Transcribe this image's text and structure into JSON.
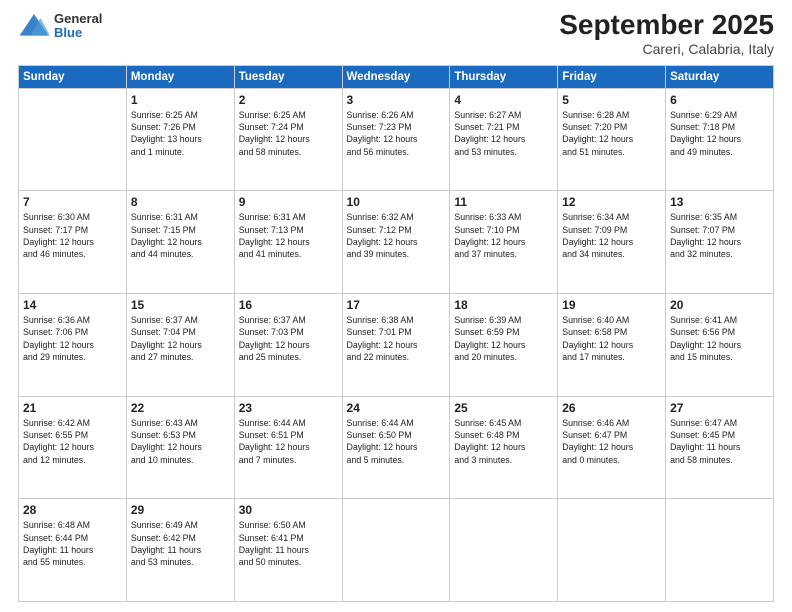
{
  "header": {
    "logo": {
      "general": "General",
      "blue": "Blue"
    },
    "title": "September 2025",
    "subtitle": "Careri, Calabria, Italy"
  },
  "weekdays": [
    "Sunday",
    "Monday",
    "Tuesday",
    "Wednesday",
    "Thursday",
    "Friday",
    "Saturday"
  ],
  "weeks": [
    [
      {
        "day": "",
        "info": ""
      },
      {
        "day": "1",
        "info": "Sunrise: 6:25 AM\nSunset: 7:26 PM\nDaylight: 13 hours\nand 1 minute."
      },
      {
        "day": "2",
        "info": "Sunrise: 6:25 AM\nSunset: 7:24 PM\nDaylight: 12 hours\nand 58 minutes."
      },
      {
        "day": "3",
        "info": "Sunrise: 6:26 AM\nSunset: 7:23 PM\nDaylight: 12 hours\nand 56 minutes."
      },
      {
        "day": "4",
        "info": "Sunrise: 6:27 AM\nSunset: 7:21 PM\nDaylight: 12 hours\nand 53 minutes."
      },
      {
        "day": "5",
        "info": "Sunrise: 6:28 AM\nSunset: 7:20 PM\nDaylight: 12 hours\nand 51 minutes."
      },
      {
        "day": "6",
        "info": "Sunrise: 6:29 AM\nSunset: 7:18 PM\nDaylight: 12 hours\nand 49 minutes."
      }
    ],
    [
      {
        "day": "7",
        "info": "Sunrise: 6:30 AM\nSunset: 7:17 PM\nDaylight: 12 hours\nand 46 minutes."
      },
      {
        "day": "8",
        "info": "Sunrise: 6:31 AM\nSunset: 7:15 PM\nDaylight: 12 hours\nand 44 minutes."
      },
      {
        "day": "9",
        "info": "Sunrise: 6:31 AM\nSunset: 7:13 PM\nDaylight: 12 hours\nand 41 minutes."
      },
      {
        "day": "10",
        "info": "Sunrise: 6:32 AM\nSunset: 7:12 PM\nDaylight: 12 hours\nand 39 minutes."
      },
      {
        "day": "11",
        "info": "Sunrise: 6:33 AM\nSunset: 7:10 PM\nDaylight: 12 hours\nand 37 minutes."
      },
      {
        "day": "12",
        "info": "Sunrise: 6:34 AM\nSunset: 7:09 PM\nDaylight: 12 hours\nand 34 minutes."
      },
      {
        "day": "13",
        "info": "Sunrise: 6:35 AM\nSunset: 7:07 PM\nDaylight: 12 hours\nand 32 minutes."
      }
    ],
    [
      {
        "day": "14",
        "info": "Sunrise: 6:36 AM\nSunset: 7:06 PM\nDaylight: 12 hours\nand 29 minutes."
      },
      {
        "day": "15",
        "info": "Sunrise: 6:37 AM\nSunset: 7:04 PM\nDaylight: 12 hours\nand 27 minutes."
      },
      {
        "day": "16",
        "info": "Sunrise: 6:37 AM\nSunset: 7:03 PM\nDaylight: 12 hours\nand 25 minutes."
      },
      {
        "day": "17",
        "info": "Sunrise: 6:38 AM\nSunset: 7:01 PM\nDaylight: 12 hours\nand 22 minutes."
      },
      {
        "day": "18",
        "info": "Sunrise: 6:39 AM\nSunset: 6:59 PM\nDaylight: 12 hours\nand 20 minutes."
      },
      {
        "day": "19",
        "info": "Sunrise: 6:40 AM\nSunset: 6:58 PM\nDaylight: 12 hours\nand 17 minutes."
      },
      {
        "day": "20",
        "info": "Sunrise: 6:41 AM\nSunset: 6:56 PM\nDaylight: 12 hours\nand 15 minutes."
      }
    ],
    [
      {
        "day": "21",
        "info": "Sunrise: 6:42 AM\nSunset: 6:55 PM\nDaylight: 12 hours\nand 12 minutes."
      },
      {
        "day": "22",
        "info": "Sunrise: 6:43 AM\nSunset: 6:53 PM\nDaylight: 12 hours\nand 10 minutes."
      },
      {
        "day": "23",
        "info": "Sunrise: 6:44 AM\nSunset: 6:51 PM\nDaylight: 12 hours\nand 7 minutes."
      },
      {
        "day": "24",
        "info": "Sunrise: 6:44 AM\nSunset: 6:50 PM\nDaylight: 12 hours\nand 5 minutes."
      },
      {
        "day": "25",
        "info": "Sunrise: 6:45 AM\nSunset: 6:48 PM\nDaylight: 12 hours\nand 3 minutes."
      },
      {
        "day": "26",
        "info": "Sunrise: 6:46 AM\nSunset: 6:47 PM\nDaylight: 12 hours\nand 0 minutes."
      },
      {
        "day": "27",
        "info": "Sunrise: 6:47 AM\nSunset: 6:45 PM\nDaylight: 11 hours\nand 58 minutes."
      }
    ],
    [
      {
        "day": "28",
        "info": "Sunrise: 6:48 AM\nSunset: 6:44 PM\nDaylight: 11 hours\nand 55 minutes."
      },
      {
        "day": "29",
        "info": "Sunrise: 6:49 AM\nSunset: 6:42 PM\nDaylight: 11 hours\nand 53 minutes."
      },
      {
        "day": "30",
        "info": "Sunrise: 6:50 AM\nSunset: 6:41 PM\nDaylight: 11 hours\nand 50 minutes."
      },
      {
        "day": "",
        "info": ""
      },
      {
        "day": "",
        "info": ""
      },
      {
        "day": "",
        "info": ""
      },
      {
        "day": "",
        "info": ""
      }
    ]
  ]
}
